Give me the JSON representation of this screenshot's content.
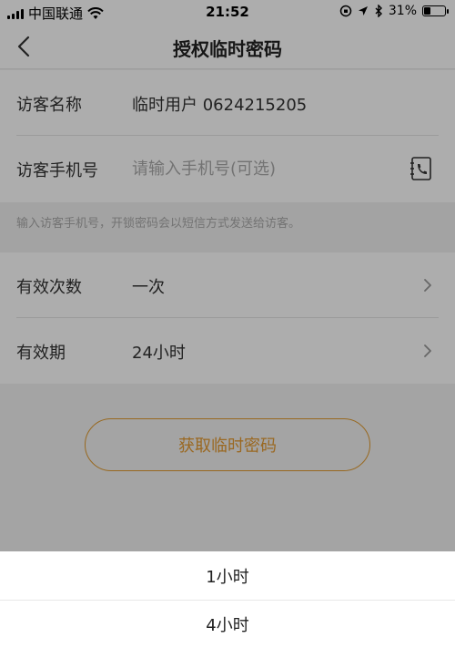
{
  "status_bar": {
    "carrier": "中国联通",
    "time": "21:52",
    "battery_text": "31%",
    "battery_level": 0.31
  },
  "nav": {
    "title": "授权临时密码"
  },
  "form": {
    "visitor_name": {
      "label": "访客名称",
      "value": "临时用户 0624215205"
    },
    "visitor_phone": {
      "label": "访客手机号",
      "placeholder": "请输入手机号(可选)"
    },
    "hint": "输入访客手机号，开锁密码会以短信方式发送给访客。",
    "valid_times": {
      "label": "有效次数",
      "value": "一次"
    },
    "valid_period": {
      "label": "有效期",
      "value": "24小时"
    }
  },
  "actions": {
    "get_password": "获取临时密码"
  },
  "picker": {
    "options": [
      "1小时",
      "4小时"
    ]
  },
  "colors": {
    "accent": "#e39a32",
    "overlay": "rgba(0,0,0,0.32)"
  }
}
